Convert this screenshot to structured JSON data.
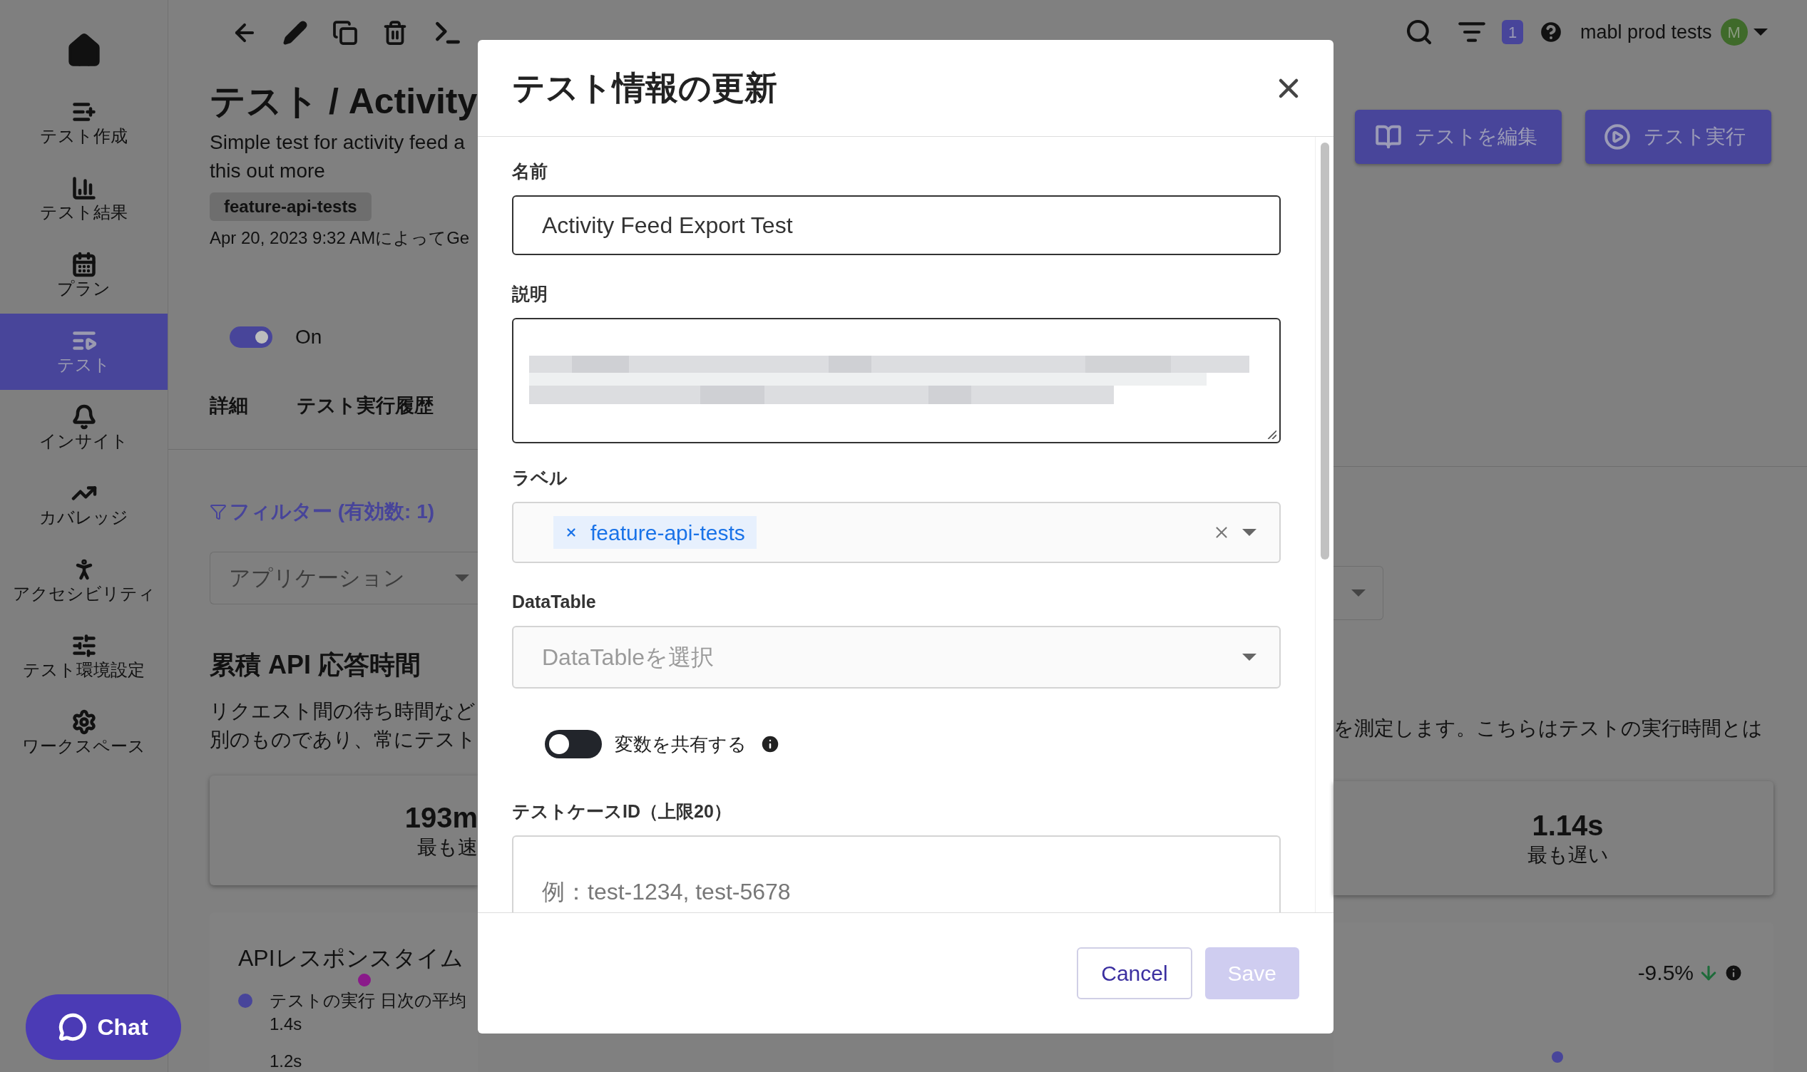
{
  "sidebar": {
    "items": [
      {
        "label": "テスト作成",
        "selected": false
      },
      {
        "label": "テスト結果",
        "selected": false
      },
      {
        "label": "プラン",
        "selected": false
      },
      {
        "label": "テスト",
        "selected": true
      },
      {
        "label": "インサイト",
        "selected": false
      },
      {
        "label": "カバレッジ",
        "selected": false
      },
      {
        "label": "アクセシビリティ",
        "selected": false
      },
      {
        "label": "テスト環境設定",
        "selected": false
      },
      {
        "label": "ワークスペース",
        "selected": false
      }
    ]
  },
  "header": {
    "notification_count": "1",
    "account": "mabl prod tests",
    "avatar_initial": "M",
    "buttons": [
      "テストを編集",
      "テスト実行"
    ]
  },
  "test": {
    "title": "テスト / Activity",
    "description_lines": [
      "Simple test for activity feed a",
      "this out more"
    ],
    "tag": "feature-api-tests",
    "meta": "Apr 20, 2023 9:32 AMによってGe",
    "toggle": {
      "label": "On",
      "on": true
    },
    "tabs": [
      "詳細",
      "テスト実行履歴"
    ]
  },
  "filters": {
    "title": "フィルター (有効数: 1)",
    "dropdown_placeholder": "アプリケーション"
  },
  "section": {
    "title": "累積 API 応答時間",
    "text_left": [
      "リクエスト間の待ち時間など",
      "別のものであり、常にテスト"
    ],
    "text_right": "を測定します。こちらはテストの実行時間とは",
    "stats": [
      {
        "value": "193m",
        "label": "最も速"
      },
      {
        "value": "1.14s",
        "label": "最も遅い"
      }
    ]
  },
  "chart_card": {
    "title": "APIレスポンスタイム",
    "change": "-9.5%",
    "legend": "テストの実行 日次の平均",
    "axis_labels": [
      "1.4s",
      "1.2s"
    ]
  },
  "chat_button": "Chat",
  "dialog": {
    "title": "テスト情報の更新",
    "name": {
      "label": "名前",
      "value": "Activity Feed Export Test"
    },
    "description": {
      "label": "説明"
    },
    "labels": {
      "label": "ラベル",
      "chips": [
        "feature-api-tests"
      ]
    },
    "datatable": {
      "label": "DataTable",
      "placeholder": "DataTableを選択"
    },
    "share_variables": {
      "label": "変数を共有する",
      "on": false
    },
    "test_case_ids": {
      "label": "テストケースID（上限20）",
      "placeholder": "例：test-1234, test-5678"
    },
    "buttons": [
      {
        "label": "Cancel",
        "kind": "secondary",
        "disabled": false
      },
      {
        "label": "Save",
        "kind": "primary",
        "disabled": true
      }
    ]
  }
}
